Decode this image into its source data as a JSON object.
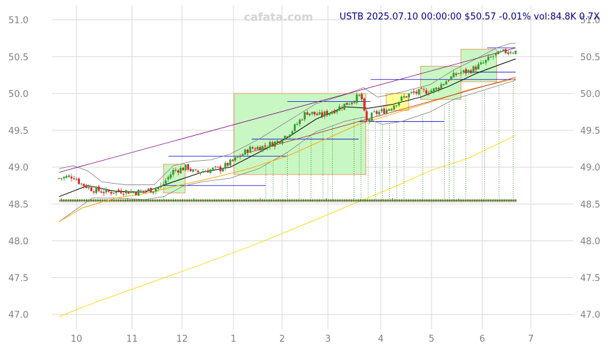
{
  "watermark": "cafata.com",
  "header": {
    "text": "USTB 2025.07.10 00:00:00 $50.57 -0.01% vol:84.8K 0.7X"
  },
  "colors": {
    "up": "#2ca02c",
    "down": "#d62728",
    "grid": "#d9d9d9",
    "header": "#00008b",
    "box_green": "#c9f7c3",
    "box_yellow": "#ffff99",
    "box_border": "#e8a070",
    "ma_short": "#000000",
    "ma_mid": "#ffa500",
    "ma_long": "#ffd700",
    "band": "#808080",
    "channel": "#800080",
    "level_line": "#0000cd",
    "vol_bar": "#008000"
  },
  "chart_data": {
    "type": "candlestick",
    "title": "USTB 2025.07.10 00:00:00 $50.57 -0.01% vol:84.8K 0.7X",
    "x_ticks": [
      "10",
      "11",
      "12",
      "1",
      "2",
      "3",
      "4",
      "5",
      "6",
      "7"
    ],
    "y_ticks": [
      47.0,
      47.5,
      48.0,
      48.5,
      49.0,
      49.5,
      50.0,
      50.5,
      51.0
    ],
    "y_tick_labels": [
      "47.0",
      "47.5",
      "48.0",
      "48.5",
      "49.0",
      "49.5",
      "50.0",
      "50.5",
      "51.0"
    ],
    "ylim": [
      46.8,
      51.1
    ],
    "x_range": [
      0,
      10.3
    ],
    "grid": true,
    "y_axis": "both",
    "close_path": [
      [
        0.0,
        48.85
      ],
      [
        0.3,
        48.88
      ],
      [
        0.45,
        48.78
      ],
      [
        0.7,
        48.7
      ],
      [
        1.0,
        48.66
      ],
      [
        1.3,
        48.68
      ],
      [
        1.6,
        48.66
      ],
      [
        1.8,
        48.68
      ],
      [
        2.0,
        48.7
      ],
      [
        2.15,
        48.74
      ],
      [
        2.4,
        48.95
      ],
      [
        2.7,
        49.0
      ],
      [
        2.85,
        48.92
      ],
      [
        3.1,
        48.96
      ],
      [
        3.4,
        48.98
      ],
      [
        3.7,
        49.1
      ],
      [
        4.0,
        49.25
      ],
      [
        4.3,
        49.28
      ],
      [
        4.6,
        49.35
      ],
      [
        4.9,
        49.5
      ],
      [
        5.2,
        49.75
      ],
      [
        5.5,
        49.7
      ],
      [
        5.8,
        49.78
      ],
      [
        6.1,
        49.88
      ],
      [
        6.35,
        49.98
      ],
      [
        6.45,
        49.6
      ],
      [
        6.6,
        49.72
      ],
      [
        6.9,
        49.78
      ],
      [
        7.1,
        49.88
      ],
      [
        7.25,
        49.95
      ],
      [
        7.4,
        50.0
      ],
      [
        7.6,
        50.02
      ],
      [
        7.9,
        50.05
      ],
      [
        8.15,
        50.18
      ],
      [
        8.4,
        50.28
      ],
      [
        8.6,
        50.3
      ],
      [
        8.9,
        50.4
      ],
      [
        9.1,
        50.5
      ],
      [
        9.3,
        50.55
      ],
      [
        9.45,
        50.58
      ],
      [
        9.6,
        50.57
      ]
    ],
    "ma_short_path": [
      [
        0.0,
        48.6
      ],
      [
        0.6,
        48.75
      ],
      [
        1.2,
        48.67
      ],
      [
        1.8,
        48.66
      ],
      [
        2.4,
        48.8
      ],
      [
        3.0,
        48.93
      ],
      [
        3.6,
        49.0
      ],
      [
        4.2,
        49.2
      ],
      [
        4.8,
        49.4
      ],
      [
        5.4,
        49.65
      ],
      [
        6.0,
        49.82
      ],
      [
        6.5,
        49.8
      ],
      [
        7.0,
        49.85
      ],
      [
        7.6,
        49.95
      ],
      [
        8.2,
        50.1
      ],
      [
        8.8,
        50.28
      ],
      [
        9.3,
        50.4
      ],
      [
        9.6,
        50.47
      ]
    ],
    "ma_mid_path": [
      [
        0.0,
        48.26
      ],
      [
        0.5,
        48.45
      ],
      [
        1.2,
        48.58
      ],
      [
        1.8,
        48.64
      ],
      [
        2.5,
        48.75
      ],
      [
        3.2,
        48.85
      ],
      [
        4.0,
        48.98
      ],
      [
        4.8,
        49.15
      ],
      [
        5.6,
        49.38
      ],
      [
        6.3,
        49.58
      ],
      [
        7.0,
        49.72
      ],
      [
        7.8,
        49.88
      ],
      [
        8.6,
        50.05
      ],
      [
        9.6,
        50.2
      ]
    ],
    "ma_long_path": [
      [
        0.0,
        46.97
      ],
      [
        0.5,
        47.1
      ],
      [
        1.0,
        47.22
      ],
      [
        2.0,
        47.45
      ],
      [
        3.0,
        47.68
      ],
      [
        4.0,
        47.92
      ],
      [
        5.0,
        48.18
      ],
      [
        6.0,
        48.45
      ],
      [
        7.0,
        48.72
      ],
      [
        7.8,
        48.95
      ],
      [
        8.6,
        49.12
      ],
      [
        9.6,
        49.43
      ]
    ],
    "band_upper_path": [
      [
        0.0,
        48.98
      ],
      [
        0.3,
        49.02
      ],
      [
        0.6,
        48.95
      ],
      [
        0.9,
        48.8
      ],
      [
        1.4,
        48.76
      ],
      [
        2.0,
        48.76
      ],
      [
        2.4,
        49.02
      ],
      [
        2.8,
        49.08
      ],
      [
        3.2,
        49.1
      ],
      [
        3.6,
        49.18
      ],
      [
        4.2,
        49.38
      ],
      [
        4.8,
        49.62
      ],
      [
        5.4,
        49.86
      ],
      [
        6.0,
        49.98
      ],
      [
        6.4,
        50.08
      ],
      [
        6.7,
        49.95
      ],
      [
        7.2,
        50.02
      ],
      [
        7.8,
        50.12
      ],
      [
        8.3,
        50.32
      ],
      [
        8.8,
        50.48
      ],
      [
        9.2,
        50.62
      ],
      [
        9.5,
        50.68
      ],
      [
        9.6,
        50.68
      ]
    ],
    "band_lower_path": [
      [
        0.0,
        48.26
      ],
      [
        0.3,
        48.4
      ],
      [
        0.7,
        48.58
      ],
      [
        1.2,
        48.58
      ],
      [
        1.8,
        48.56
      ],
      [
        2.2,
        48.6
      ],
      [
        2.6,
        48.74
      ],
      [
        3.0,
        48.8
      ],
      [
        3.6,
        48.85
      ],
      [
        4.2,
        48.98
      ],
      [
        4.8,
        49.2
      ],
      [
        5.4,
        49.48
      ],
      [
        6.0,
        49.62
      ],
      [
        6.4,
        49.68
      ],
      [
        6.8,
        49.58
      ],
      [
        7.2,
        49.62
      ],
      [
        7.8,
        49.75
      ],
      [
        8.3,
        49.92
      ],
      [
        8.8,
        50.02
      ],
      [
        9.2,
        50.1
      ],
      [
        9.6,
        50.18
      ]
    ],
    "channel_upper": [
      [
        0.0,
        48.93
      ],
      [
        9.6,
        50.62
      ]
    ],
    "channel_lower": [
      [
        4.0,
        49.2
      ],
      [
        9.6,
        50.22
      ]
    ],
    "boxes": [
      {
        "x0": 2.2,
        "x1": 2.65,
        "y0": 48.65,
        "y1": 49.04,
        "fill": "green"
      },
      {
        "x0": 3.68,
        "x1": 6.45,
        "y0": 48.9,
        "y1": 50.0,
        "fill": "green"
      },
      {
        "x0": 6.88,
        "x1": 7.35,
        "y0": 49.77,
        "y1": 50.0,
        "fill": "yellow"
      },
      {
        "x0": 7.6,
        "x1": 8.45,
        "y0": 49.92,
        "y1": 50.37,
        "fill": "green"
      },
      {
        "x0": 8.45,
        "x1": 9.2,
        "y0": 50.16,
        "y1": 50.6,
        "fill": "green"
      }
    ],
    "levels": [
      {
        "x0": 2.2,
        "x1": 4.35,
        "y": 48.75
      },
      {
        "x0": 2.3,
        "x1": 4.8,
        "y": 49.15
      },
      {
        "x0": 4.05,
        "x1": 6.3,
        "y": 49.38
      },
      {
        "x0": 4.8,
        "x1": 6.55,
        "y": 49.89
      },
      {
        "x0": 6.3,
        "x1": 8.1,
        "y": 49.62
      },
      {
        "x0": 6.55,
        "x1": 9.6,
        "y": 50.19
      },
      {
        "x0": 8.5,
        "x1": 9.6,
        "y": 50.29
      },
      {
        "x0": 9.0,
        "x1": 9.6,
        "y": 50.62
      }
    ],
    "volume_baseline": 48.55
  }
}
